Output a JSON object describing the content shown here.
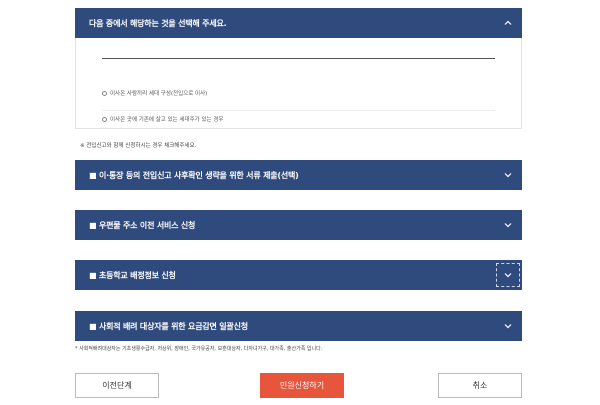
{
  "section1": {
    "title": "다음 중에서 해당하는 것을 선택해 주세요.",
    "options": [
      "이사온 사람끼리 세대 구성(전입으로 이사)",
      "이사온 곳에 기존에 살고 있는 세대주가 있는 경우"
    ]
  },
  "note_top": "※ 전입신고와 함께 신청하시는 경우 체크해주세요.",
  "sections": [
    "■ 이·통장 등의 전입신고 사후확인 생략을 위한 서류 제출(선택)",
    "■ 우편물 주소 이전 서비스 신청",
    "■ 초등학교 배정정보 신청",
    "■ 사회적 배려 대상자를 위한 요금감면 일괄신청"
  ],
  "note_bottom": "* 사회적배려대상자는 기초생활수급자, 저상위, 장애인, 국가유공자, 보훈대상자, 다자녀가구, 대가족, 출산가족 입니다.",
  "buttons": {
    "prev": "이전단계",
    "submit": "민원신청하기",
    "cancel": "취소"
  },
  "colors": {
    "bar": "#2f4a7d",
    "primary": "#e8553d"
  },
  "icons": [
    "chevron-up-icon",
    "chevron-down-icon"
  ]
}
